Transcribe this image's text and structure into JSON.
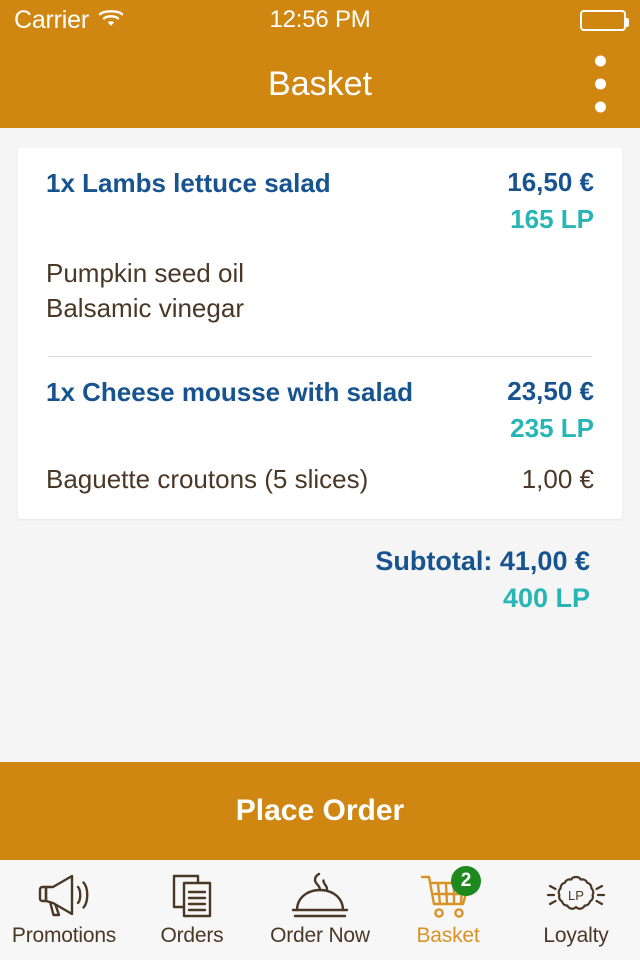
{
  "status_bar": {
    "carrier": "Carrier",
    "wifi_icon": "wifi-icon",
    "time": "12:56 PM",
    "battery_icon": "battery-icon"
  },
  "header": {
    "title": "Basket",
    "overflow_icon": "more-vertical-icon"
  },
  "basket": {
    "items": [
      {
        "title": "1x Lambs lettuce salad",
        "price": "16,50 €",
        "points": "165 LP",
        "options": [
          {
            "name": "Pumpkin seed oil",
            "price": ""
          },
          {
            "name": "Balsamic vinegar",
            "price": ""
          }
        ]
      },
      {
        "title": "1x Cheese mousse with salad",
        "price": "23,50 €",
        "points": "235 LP",
        "options": [
          {
            "name": "Baguette croutons (5 slices)",
            "price": "1,00 €"
          }
        ]
      }
    ],
    "subtotal_label": "Subtotal: 41,00 €",
    "subtotal_points": "400 LP"
  },
  "place_order": {
    "label": "Place Order"
  },
  "tabbar": {
    "tabs": [
      {
        "label": "Promotions",
        "icon": "megaphone-icon",
        "active": false,
        "badge": ""
      },
      {
        "label": "Orders",
        "icon": "documents-icon",
        "active": false,
        "badge": ""
      },
      {
        "label": "Order Now",
        "icon": "food-cloche-icon",
        "active": false,
        "badge": ""
      },
      {
        "label": "Basket",
        "icon": "shopping-cart-icon",
        "active": true,
        "badge": "2"
      },
      {
        "label": "Loyalty",
        "icon": "loyalty-points-icon",
        "active": false,
        "badge": ""
      }
    ]
  },
  "colors": {
    "brand_orange": "#cf8712",
    "title_blue": "#17548f",
    "points_teal": "#27b5b5",
    "option_brown": "#4a3827",
    "badge_green": "#1e8a1e",
    "page_bg": "#f5f5f5"
  }
}
